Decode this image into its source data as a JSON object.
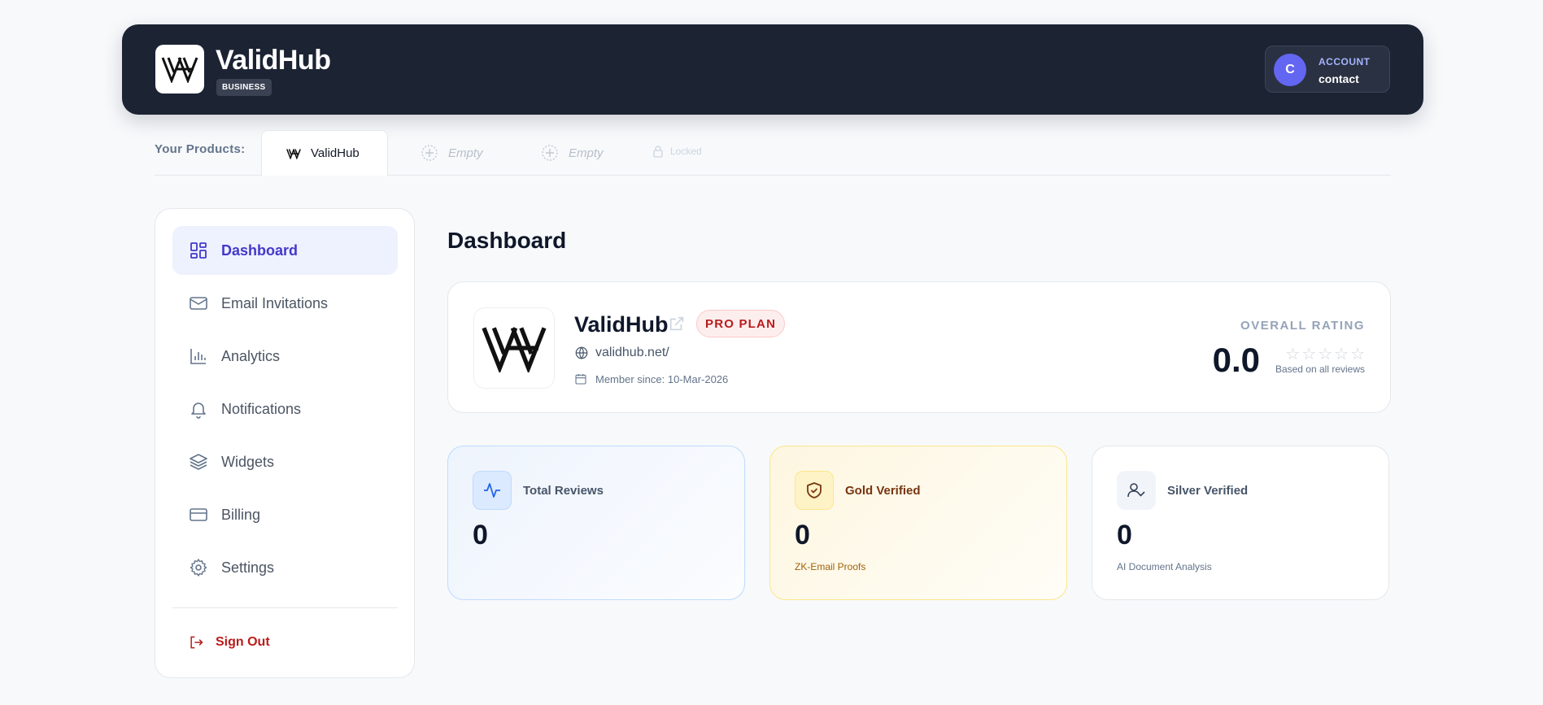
{
  "header": {
    "brand_name": "ValidHub",
    "brand_badge": "BUSINESS",
    "account_initial": "C",
    "account_label": "ACCOUNT",
    "account_name": "contact"
  },
  "products": {
    "label": "Your Products:",
    "active": "ValidHub",
    "empty1": "Empty",
    "empty2": "Empty",
    "locked": "Locked"
  },
  "sidebar": {
    "items": [
      {
        "label": "Dashboard",
        "icon": "dashboard-icon",
        "active": true
      },
      {
        "label": "Email Invitations",
        "icon": "mail-icon"
      },
      {
        "label": "Analytics",
        "icon": "bar-chart-icon"
      },
      {
        "label": "Notifications",
        "icon": "bell-icon"
      },
      {
        "label": "Widgets",
        "icon": "layers-icon"
      },
      {
        "label": "Billing",
        "icon": "credit-card-icon"
      },
      {
        "label": "Settings",
        "icon": "gear-icon"
      }
    ],
    "signout": "Sign Out"
  },
  "main": {
    "title": "Dashboard",
    "profile": {
      "name": "ValidHub",
      "plan": "PRO PLAN",
      "url": "validhub.net/",
      "member_since": "Member since: 10-Mar-2026",
      "rating_label": "OVERALL RATING",
      "rating_value": "0.0",
      "rating_sub": "Based on all reviews",
      "stars": 0
    },
    "stats": [
      {
        "label": "Total Reviews",
        "value": "0",
        "sub": ""
      },
      {
        "label": "Gold Verified",
        "value": "0",
        "sub": "ZK-Email Proofs"
      },
      {
        "label": "Silver Verified",
        "value": "0",
        "sub": "AI Document Analysis"
      }
    ]
  },
  "colors": {
    "accent": "#4338ca",
    "header_bg": "#1c2333",
    "danger": "#b91c1c"
  }
}
